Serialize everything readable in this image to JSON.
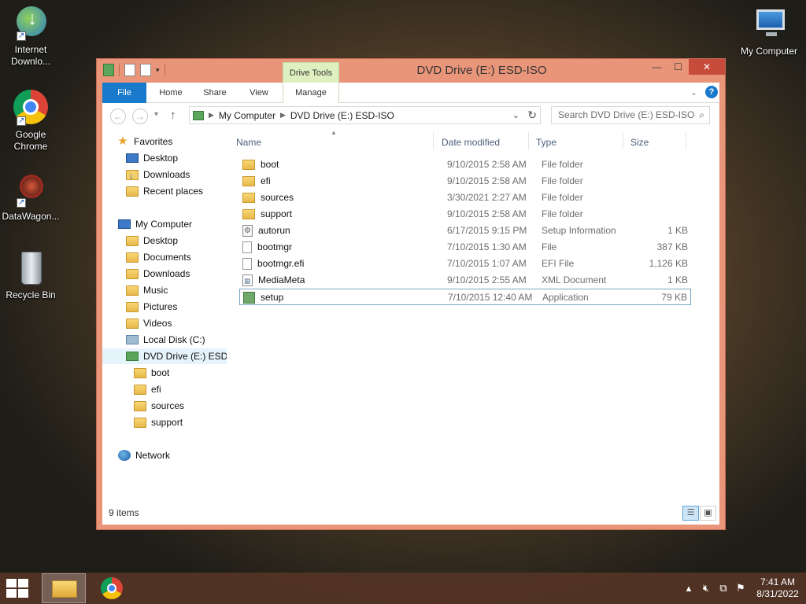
{
  "desktop": {
    "icons": [
      {
        "label": "Internet Downlo..."
      },
      {
        "label": "Google Chrome"
      },
      {
        "label": "DataWagon..."
      },
      {
        "label": "Recycle Bin"
      },
      {
        "label": "My Computer"
      }
    ]
  },
  "window": {
    "title": "DVD Drive (E:) ESD-ISO",
    "contextual_tab": "Drive Tools",
    "controls": {
      "minimize": "—",
      "maximize": "☐",
      "close": "✕"
    },
    "ribbon_tabs": [
      "File",
      "Home",
      "Share",
      "View",
      "Manage"
    ],
    "address": {
      "crumbs": [
        "My Computer",
        "DVD Drive (E:) ESD-ISO"
      ]
    },
    "search": {
      "placeholder": "Search DVD Drive (E:) ESD-ISO"
    },
    "nav_pane": {
      "favorites": {
        "label": "Favorites",
        "items": [
          "Desktop",
          "Downloads",
          "Recent places"
        ]
      },
      "computer": {
        "label": "My Computer",
        "items": [
          "Desktop",
          "Documents",
          "Downloads",
          "Music",
          "Pictures",
          "Videos",
          "Local Disk (C:)",
          "DVD Drive (E:) ESD-ISO"
        ]
      },
      "dvd_children": [
        "boot",
        "efi",
        "sources",
        "support"
      ],
      "network": {
        "label": "Network"
      }
    },
    "columns": [
      "Name",
      "Date modified",
      "Type",
      "Size"
    ],
    "files": [
      {
        "name": "boot",
        "date": "9/10/2015 2:58 AM",
        "type": "File folder",
        "size": "",
        "icon": "folder-icon"
      },
      {
        "name": "efi",
        "date": "9/10/2015 2:58 AM",
        "type": "File folder",
        "size": "",
        "icon": "folder-icon"
      },
      {
        "name": "sources",
        "date": "3/30/2021 2:27 AM",
        "type": "File folder",
        "size": "",
        "icon": "folder-icon"
      },
      {
        "name": "support",
        "date": "9/10/2015 2:58 AM",
        "type": "File folder",
        "size": "",
        "icon": "folder-icon"
      },
      {
        "name": "autorun",
        "date": "6/17/2015 9:15 PM",
        "type": "Setup Information",
        "size": "1 KB",
        "icon": "setup-info-icon"
      },
      {
        "name": "bootmgr",
        "date": "7/10/2015 1:30 AM",
        "type": "File",
        "size": "387 KB",
        "icon": "file-icon"
      },
      {
        "name": "bootmgr.efi",
        "date": "7/10/2015 1:07 AM",
        "type": "EFI File",
        "size": "1,126 KB",
        "icon": "file-icon"
      },
      {
        "name": "MediaMeta",
        "date": "9/10/2015 2:55 AM",
        "type": "XML Document",
        "size": "1 KB",
        "icon": "xml-document-icon"
      },
      {
        "name": "setup",
        "date": "7/10/2015 12:40 AM",
        "type": "Application",
        "size": "79 KB",
        "icon": "application-icon"
      }
    ],
    "status": {
      "item_count": "9 items"
    }
  },
  "taskbar": {
    "time": "7:41 AM",
    "date": "8/31/2022"
  },
  "colors": {
    "window_frame": "#e9957a",
    "file_tab": "#1979ca",
    "drive_tools_tab": "#dff0c0",
    "close_button": "#c74b3b"
  }
}
